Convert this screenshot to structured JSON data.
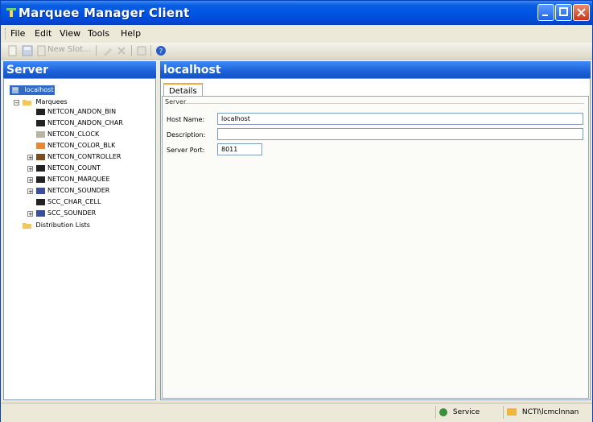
{
  "window": {
    "title": "Marquee Manager Client"
  },
  "menu": [
    "File",
    "Edit",
    "View",
    "Tools",
    "Help"
  ],
  "toolbar": {
    "new_slot_label": "New Slot..."
  },
  "left_pane": {
    "header": "Server"
  },
  "tree": {
    "root": "localhost",
    "marquees_label": "Marquees",
    "items": [
      "NETCON_ANDON_BIN",
      "NETCON_ANDON_CHAR",
      "NETCON_CLOCK",
      "NETCON_COLOR_BLK",
      "NETCON_CONTROLLER",
      "NETCON_COUNT",
      "NETCON_MARQUEE",
      "NETCON_SOUNDER",
      "SCC_CHAR_CELL",
      "SCC_SOUNDER"
    ],
    "distribution_label": "Distribution Lists"
  },
  "right_pane": {
    "header": "localhost"
  },
  "tabs": {
    "details": "Details"
  },
  "form": {
    "group": "Server",
    "host_name_label": "Host Name:",
    "host_name_value": "localhost",
    "description_label": "Description:",
    "description_value": "",
    "server_port_label": "Server Port:",
    "server_port_value": "8011"
  },
  "status": {
    "service": "Service",
    "user": "NCTI\\lcmclnnan"
  }
}
